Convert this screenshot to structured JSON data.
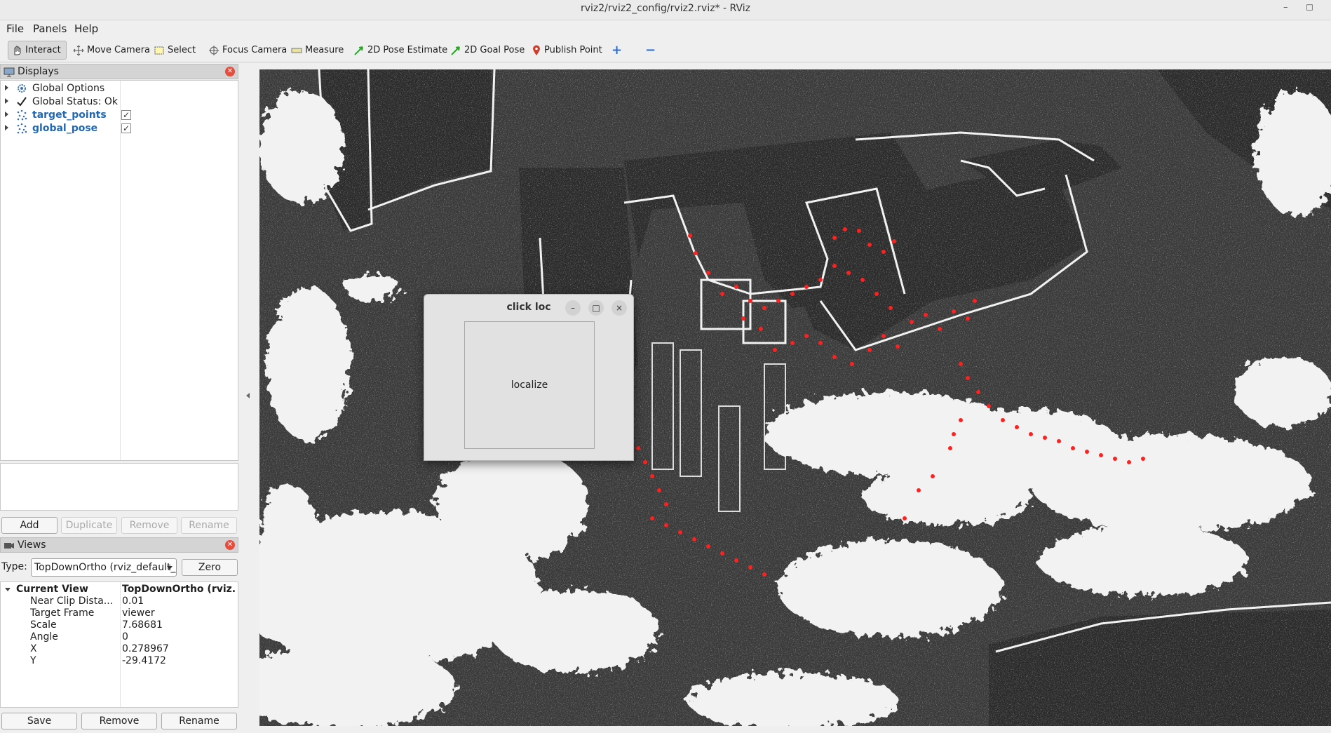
{
  "window": {
    "title": "rviz2/rviz2_config/rviz2.rviz* - RViz",
    "minimize": "–",
    "maximize": "◻"
  },
  "menu": [
    "File",
    "Panels",
    "Help"
  ],
  "toolbar": {
    "interact": "Interact",
    "move_camera": "Move Camera",
    "select": "Select",
    "focus_camera": "Focus Camera",
    "measure": "Measure",
    "pose_estimate": "2D Pose Estimate",
    "goal_pose": "2D Goal Pose",
    "publish_point": "Publish Point",
    "add_tool": "+",
    "remove_tool": "−"
  },
  "displays": {
    "title": "Displays",
    "items": [
      {
        "label": "Global Options",
        "icon": "gear-icon"
      },
      {
        "label": "Global Status: Ok",
        "icon": "check-icon"
      },
      {
        "label": "target_points",
        "icon": "points-icon",
        "checked": true
      },
      {
        "label": "global_pose",
        "icon": "points-icon",
        "checked": true
      }
    ],
    "buttons": {
      "add": "Add",
      "duplicate": "Duplicate",
      "remove": "Remove",
      "rename": "Rename"
    }
  },
  "views": {
    "title": "Views",
    "type_label": "Type:",
    "type_value": "TopDownOrtho (rviz_default_plugins)",
    "zero": "Zero",
    "current_view": {
      "key": "Current View",
      "value": "TopDownOrtho (rviz..."
    },
    "props": [
      {
        "key": "Near Clip Dista...",
        "value": "0.01"
      },
      {
        "key": "Target Frame",
        "value": "viewer"
      },
      {
        "key": "Scale",
        "value": "7.68681"
      },
      {
        "key": "Angle",
        "value": "0"
      },
      {
        "key": "X",
        "value": "0.278967"
      },
      {
        "key": "Y",
        "value": "-29.4172"
      }
    ],
    "buttons": {
      "save": "Save",
      "remove": "Remove",
      "rename": "Rename"
    }
  },
  "dialog": {
    "title": "click loc",
    "minimize": "–",
    "maximize": "□",
    "close": "×",
    "button": "localize"
  },
  "colors": {
    "points": "#ff2020",
    "cloud": "#f2f2f2",
    "background": "#3a3a3a"
  }
}
